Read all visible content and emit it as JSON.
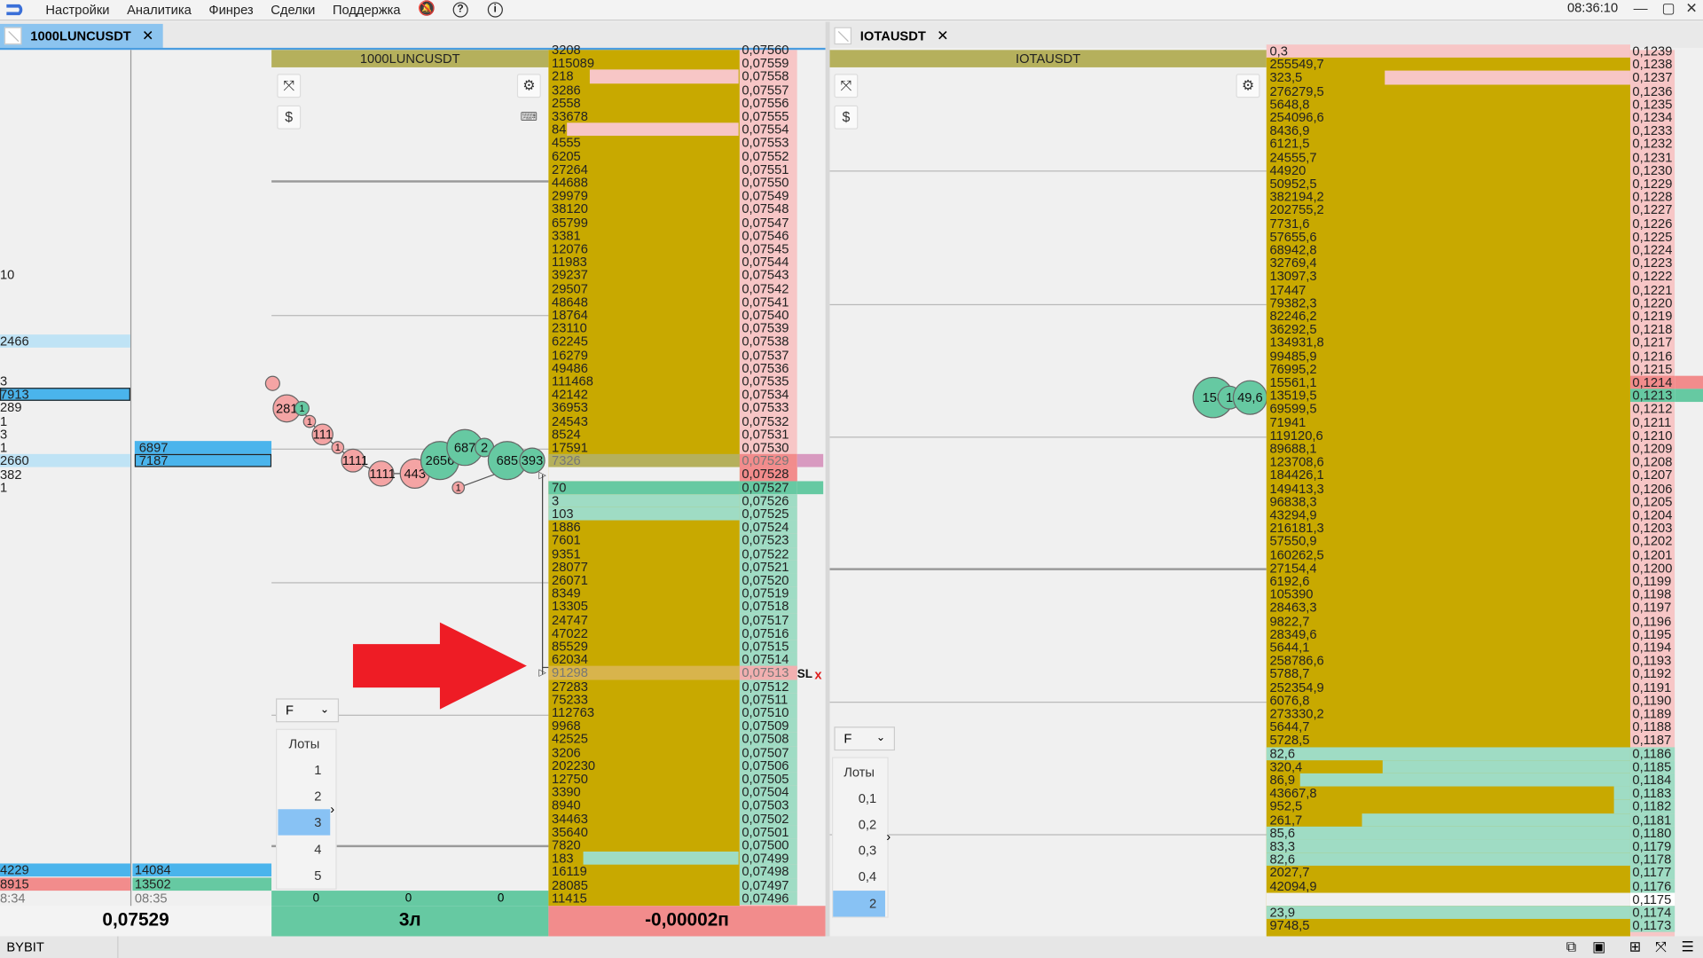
{
  "menu": {
    "items": [
      "Настройки",
      "Аналитика",
      "Финрез",
      "Сделки",
      "Поддержка"
    ],
    "clock": "08:36:10"
  },
  "tabs": [
    {
      "label": "1000LUNCUSDT",
      "active": true
    },
    {
      "label": "IOTAUSDT",
      "active": false
    }
  ],
  "left_panel": {
    "left_col": [
      "10",
      "2466",
      "3",
      "7913",
      "289",
      "1",
      "3",
      "1",
      "2660",
      "382",
      "1"
    ],
    "mid_col": [
      "6897",
      "7187"
    ],
    "bottom_left": [
      "4229",
      "8915",
      "8:34"
    ],
    "bottom_mid": [
      "14084",
      "13502",
      "08:35"
    ],
    "price": "0,07529"
  },
  "chart1": {
    "title": "1000LUNCUSDT",
    "bubbles": [
      {
        "label": "281",
        "color": "red"
      },
      {
        "label": "1",
        "color": "green"
      },
      {
        "label": "1",
        "color": "red"
      },
      {
        "label": "111",
        "color": "red"
      },
      {
        "label": "1",
        "color": "red"
      },
      {
        "label": "1111",
        "color": "red"
      },
      {
        "label": "1111",
        "color": "red"
      },
      {
        "label": "443",
        "color": "red"
      },
      {
        "label": "2656",
        "color": "green"
      },
      {
        "label": "687",
        "color": "green"
      },
      {
        "label": "2",
        "color": "green"
      },
      {
        "label": "685",
        "color": "green"
      },
      {
        "label": "393",
        "color": "green"
      },
      {
        "label": "1",
        "color": "red"
      }
    ],
    "dropdown": "F",
    "lots_header": "Лоты",
    "lots": [
      "1",
      "2",
      "3",
      "4",
      "5"
    ],
    "selected_lot": "3",
    "bottom_vals": [
      "0",
      "0",
      "0"
    ],
    "position": "3л",
    "pnl": "-0,00002п"
  },
  "orderbook1": {
    "volumes": [
      "3208",
      "115089",
      "218",
      "3286",
      "2558",
      "33678",
      "84",
      "4555",
      "6205",
      "27264",
      "44688",
      "29979",
      "38120",
      "65799",
      "3381",
      "12076",
      "11983",
      "39237",
      "29507",
      "48648",
      "18764",
      "23110",
      "62245",
      "16279",
      "49486",
      "111468",
      "42142",
      "36953",
      "24543",
      "8524",
      "17591",
      "7326",
      "",
      "70",
      "3",
      "103",
      "1886",
      "7601",
      "9351",
      "28077",
      "26071",
      "8349",
      "13305",
      "24747",
      "47022",
      "85529",
      "62034",
      "91298",
      "27283",
      "75233",
      "112763",
      "9968",
      "42525",
      "3206",
      "202230",
      "12750",
      "3390",
      "8940",
      "34463",
      "35640",
      "7820",
      "183",
      "16119",
      "28085",
      "11415"
    ],
    "prices": [
      "0,07560",
      "0,07559",
      "0,07558",
      "0,07557",
      "0,07556",
      "0,07555",
      "0,07554",
      "0,07553",
      "0,07552",
      "0,07551",
      "0,07550",
      "0,07549",
      "0,07548",
      "0,07547",
      "0,07546",
      "0,07545",
      "0,07544",
      "0,07543",
      "0,07542",
      "0,07541",
      "0,07540",
      "0,07539",
      "0,07538",
      "0,07537",
      "0,07536",
      "0,07535",
      "0,07534",
      "0,07533",
      "0,07532",
      "0,07531",
      "0,07530",
      "0,07529",
      "0,07528",
      "0,07527",
      "0,07526",
      "0,07525",
      "0,07524",
      "0,07523",
      "0,07522",
      "0,07521",
      "0,07520",
      "0,07519",
      "0,07518",
      "0,07517",
      "0,07516",
      "0,07515",
      "0,07514",
      "0,07513",
      "0,07512",
      "0,07511",
      "0,07510",
      "0,07509",
      "0,07508",
      "0,07507",
      "0,07506",
      "0,07505",
      "0,07504",
      "0,07503",
      "0,07502",
      "0,07501",
      "0,07500",
      "0,07499",
      "0,07498",
      "0,07497",
      "0,07496"
    ],
    "sl_label": "SL",
    "sl_close": "x"
  },
  "chart2": {
    "title": "IOTAUSDT",
    "bubbles": [
      {
        "label": "158",
        "color": "green"
      },
      {
        "label": "1",
        "color": "green"
      },
      {
        "label": "49,6",
        "color": "green"
      }
    ],
    "dropdown": "F",
    "lots_header": "Лоты",
    "lots": [
      "0,1",
      "0,2",
      "0,3",
      "0,4",
      "2"
    ],
    "selected_lot": "2"
  },
  "orderbook2": {
    "volumes": [
      "0,3",
      "255549,7",
      "323,5",
      "276279,5",
      "5648,8",
      "254096,6",
      "8436,9",
      "6121,5",
      "24555,7",
      "44920",
      "50952,5",
      "382194,2",
      "202755,2",
      "7731,6",
      "57655,6",
      "68942,8",
      "32769,4",
      "13097,3",
      "17447",
      "79382,3",
      "82246,2",
      "36292,5",
      "134931,8",
      "99485,9",
      "76995,2",
      "15561,1",
      "13519,5",
      "69599,5",
      "71941",
      "119120,6",
      "89688,1",
      "123708,6",
      "184426,1",
      "149413,3",
      "96838,3",
      "43294,9",
      "216181,3",
      "57550,9",
      "160262,5",
      "27154,4",
      "6192,6",
      "105390",
      "28463,3",
      "9822,7",
      "28349,6",
      "5644,1",
      "258786,6",
      "5788,7",
      "252354,9",
      "6076,8",
      "273330,2",
      "5644,7",
      "5728,5",
      "82,6",
      "320,4",
      "86,9",
      "43667,8",
      "952,5",
      "261,7",
      "85,6",
      "83,3",
      "82,6",
      "2027,7",
      "42094,9",
      "",
      "23,9",
      "9748,5"
    ],
    "prices": [
      "0,1239",
      "0,1238",
      "0,1237",
      "0,1236",
      "0,1235",
      "0,1234",
      "0,1233",
      "0,1232",
      "0,1231",
      "0,1230",
      "0,1229",
      "0,1228",
      "0,1227",
      "0,1226",
      "0,1225",
      "0,1224",
      "0,1223",
      "0,1222",
      "0,1221",
      "0,1220",
      "0,1219",
      "0,1218",
      "0,1217",
      "0,1216",
      "0,1215",
      "0,1214",
      "0,1213",
      "0,1212",
      "0,1211",
      "0,1210",
      "0,1209",
      "0,1208",
      "0,1207",
      "0,1206",
      "0,1205",
      "0,1204",
      "0,1203",
      "0,1202",
      "0,1201",
      "0,1200",
      "0,1199",
      "0,1198",
      "0,1197",
      "0,1196",
      "0,1195",
      "0,1194",
      "0,1193",
      "0,1192",
      "0,1191",
      "0,1190",
      "0,1189",
      "0,1188",
      "0,1187",
      "0,1186",
      "0,1185",
      "0,1184",
      "0,1183",
      "0,1182",
      "0,1181",
      "0,1180",
      "0,1179",
      "0,1178",
      "0,1177",
      "0,1176",
      "0,1175",
      "0,1174",
      "0,1173"
    ]
  },
  "status": {
    "exchange": "BYBIT"
  },
  "colors": {
    "ask": "#c8a900",
    "bid": "#9fdcc4",
    "ask_price": "#f7c6c6",
    "title": "#b5b05c",
    "arrow": "#ee1c25"
  }
}
